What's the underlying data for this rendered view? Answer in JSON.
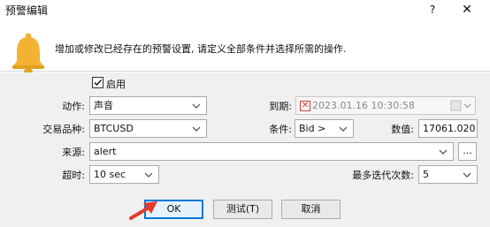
{
  "window": {
    "title": "预警编辑",
    "help_label": "?",
    "close_label": "✕"
  },
  "header": {
    "icon": "bell-icon",
    "description": "增加或修改已经存在的预警设置, 请定义全部条件并选择所需的操作."
  },
  "form": {
    "enable_checkbox": {
      "label": "启用",
      "checked": true
    },
    "action": {
      "label": "动作:",
      "value": "声音"
    },
    "expiry": {
      "label": "到期:",
      "value": "2023.01.16 10:30:58",
      "checked": false
    },
    "symbol": {
      "label": "交易品种:",
      "value": "BTCUSD"
    },
    "condition": {
      "label": "条件:",
      "value": "Bid >"
    },
    "amount": {
      "label": "数值:",
      "value": "17061.020"
    },
    "source": {
      "label": "来源:",
      "value": "alert",
      "browse_label": "..."
    },
    "timeout": {
      "label": "超时:",
      "value": "10 sec"
    },
    "max_iterations": {
      "label": "最多迭代次数:",
      "value": "5"
    }
  },
  "buttons": {
    "ok": "OK",
    "test": "测试(T)",
    "cancel": "取消"
  },
  "colors": {
    "bell": "#f2b233",
    "arrow": "#e23b2e",
    "accent": "#0078d7"
  }
}
